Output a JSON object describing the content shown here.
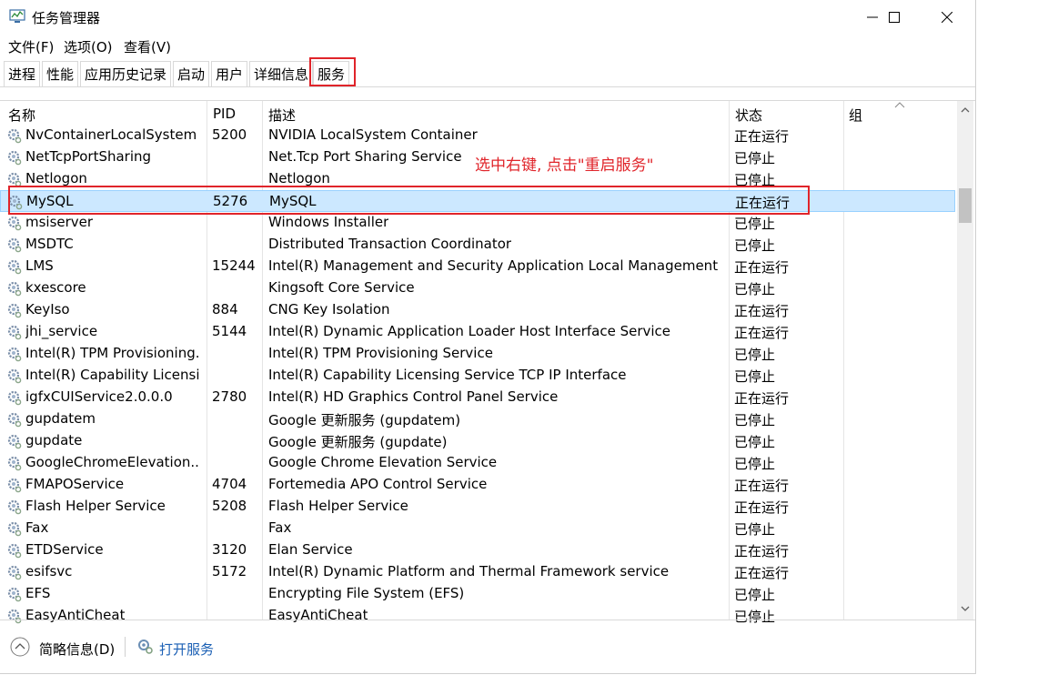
{
  "window": {
    "title": "任务管理器",
    "menu": [
      "文件(F)",
      "选项(O)",
      "查看(V)"
    ],
    "tabs": [
      "进程",
      "性能",
      "应用历史记录",
      "启动",
      "用户",
      "详细信息",
      "服务"
    ],
    "active_tab": "服务"
  },
  "table": {
    "columns": [
      "名称",
      "PID",
      "描述",
      "状态",
      "组"
    ],
    "rows": [
      {
        "name": "NvContainerLocalSystem",
        "pid": "5200",
        "desc": "NVIDIA LocalSystem Container",
        "status": "正在运行"
      },
      {
        "name": "NetTcpPortSharing",
        "pid": "",
        "desc": "Net.Tcp Port Sharing Service",
        "status": "已停止"
      },
      {
        "name": "Netlogon",
        "pid": "",
        "desc": "Netlogon",
        "status": "已停止"
      },
      {
        "name": "MySQL",
        "pid": "5276",
        "desc": "MySQL",
        "status": "正在运行"
      },
      {
        "name": "msiserver",
        "pid": "",
        "desc": "Windows Installer",
        "status": "已停止"
      },
      {
        "name": "MSDTC",
        "pid": "",
        "desc": "Distributed Transaction Coordinator",
        "status": "已停止"
      },
      {
        "name": "LMS",
        "pid": "15244",
        "desc": "Intel(R) Management and Security Application Local Management ...",
        "status": "正在运行"
      },
      {
        "name": "kxescore",
        "pid": "",
        "desc": "Kingsoft Core Service",
        "status": "已停止"
      },
      {
        "name": "KeyIso",
        "pid": "884",
        "desc": "CNG Key Isolation",
        "status": "正在运行"
      },
      {
        "name": "jhi_service",
        "pid": "5144",
        "desc": "Intel(R) Dynamic Application Loader Host Interface Service",
        "status": "正在运行"
      },
      {
        "name": "Intel(R) TPM Provisioning...",
        "pid": "",
        "desc": "Intel(R) TPM Provisioning Service",
        "status": "已停止"
      },
      {
        "name": "Intel(R) Capability Licensi...",
        "pid": "",
        "desc": "Intel(R) Capability Licensing Service TCP IP Interface",
        "status": "已停止"
      },
      {
        "name": "igfxCUIService2.0.0.0",
        "pid": "2780",
        "desc": "Intel(R) HD Graphics Control Panel Service",
        "status": "正在运行"
      },
      {
        "name": "gupdatem",
        "pid": "",
        "desc": "Google 更新服务 (gupdatem)",
        "status": "已停止"
      },
      {
        "name": "gupdate",
        "pid": "",
        "desc": "Google 更新服务 (gupdate)",
        "status": "已停止"
      },
      {
        "name": "GoogleChromeElevation...",
        "pid": "",
        "desc": "Google Chrome Elevation Service",
        "status": "已停止"
      },
      {
        "name": "FMAPOService",
        "pid": "4704",
        "desc": "Fortemedia APO Control Service",
        "status": "正在运行"
      },
      {
        "name": "Flash Helper Service",
        "pid": "5208",
        "desc": "Flash Helper Service",
        "status": "正在运行"
      },
      {
        "name": "Fax",
        "pid": "",
        "desc": "Fax",
        "status": "已停止"
      },
      {
        "name": "ETDService",
        "pid": "3120",
        "desc": "Elan Service",
        "status": "正在运行"
      },
      {
        "name": "esifsvc",
        "pid": "5172",
        "desc": "Intel(R) Dynamic Platform and Thermal Framework service",
        "status": "正在运行"
      },
      {
        "name": "EFS",
        "pid": "",
        "desc": "Encrypting File System (EFS)",
        "status": "已停止"
      },
      {
        "name": "EasyAntiCheat",
        "pid": "",
        "desc": "EasyAntiCheat",
        "status": "已停止"
      }
    ],
    "selected_row": "MySQL"
  },
  "footer": {
    "details_label": "简略信息(D)",
    "open_services_label": "打开服务"
  },
  "annotation": {
    "text": "选中右键, 点击\"重启服务\"",
    "color": "#e0242a"
  },
  "colors": {
    "selection": "#cce8ff",
    "link": "#1a5fb4"
  }
}
